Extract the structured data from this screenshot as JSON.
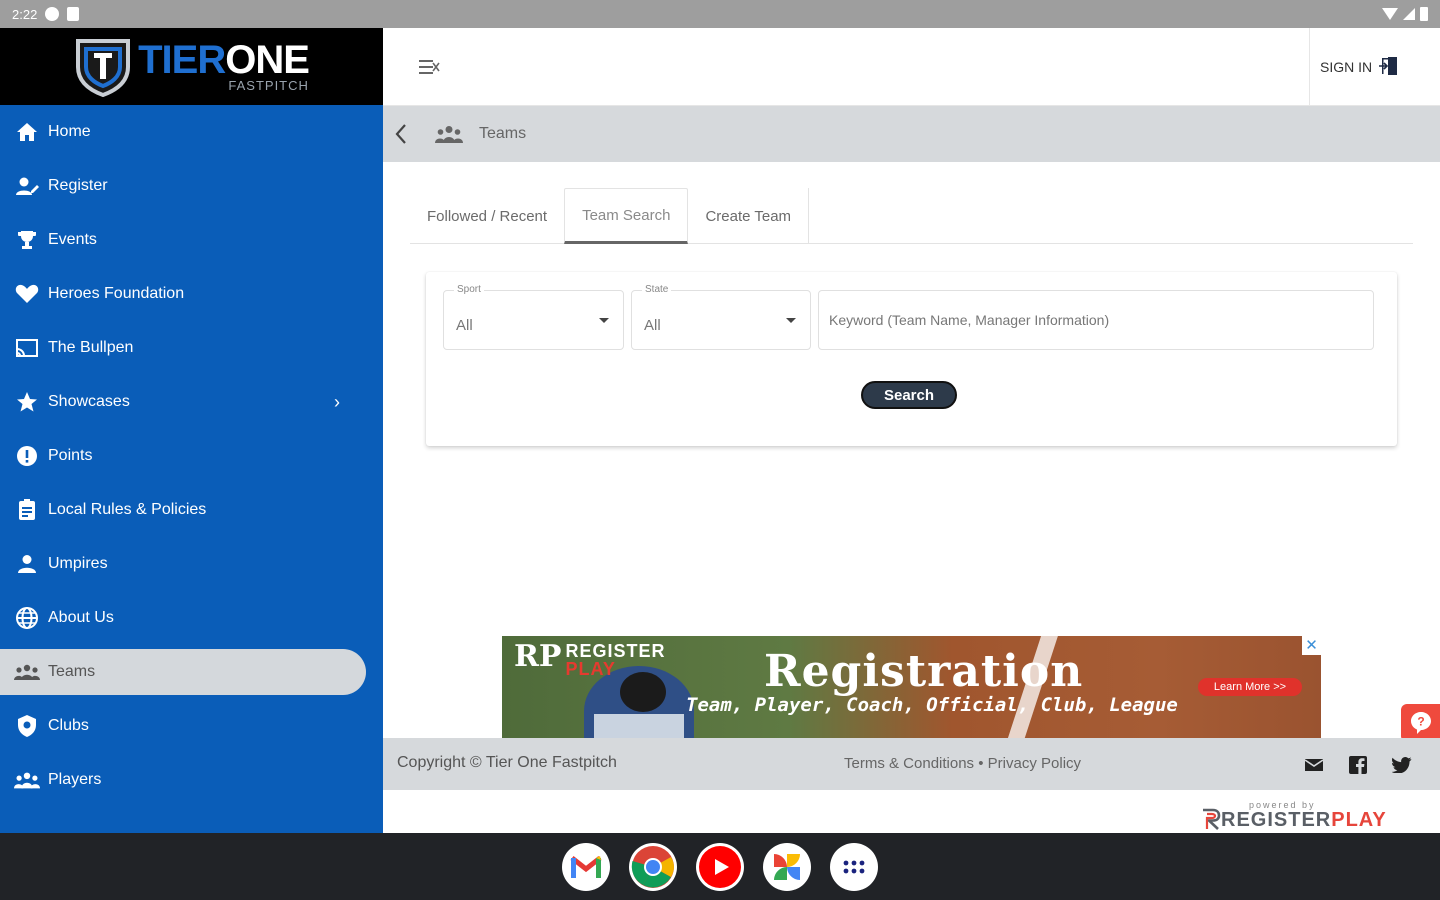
{
  "status_bar": {
    "time": "2:22"
  },
  "brand": {
    "name_part1": "TIER",
    "name_part2": "ONE",
    "sub": "FASTPITCH"
  },
  "sidebar": {
    "items": [
      {
        "label": "Home",
        "icon": "home-icon"
      },
      {
        "label": "Register",
        "icon": "person-edit-icon"
      },
      {
        "label": "Events",
        "icon": "trophy-icon"
      },
      {
        "label": "Heroes Foundation",
        "icon": "heart-icon"
      },
      {
        "label": "The Bullpen",
        "icon": "cast-icon"
      },
      {
        "label": "Showcases",
        "icon": "star-icon"
      },
      {
        "label": "Points",
        "icon": "alert-icon"
      },
      {
        "label": "Local Rules & Policies",
        "icon": "document-icon"
      },
      {
        "label": "Umpires",
        "icon": "person-icon"
      },
      {
        "label": "About Us",
        "icon": "globe-icon"
      },
      {
        "label": "Teams",
        "icon": "team-icon"
      },
      {
        "label": "Clubs",
        "icon": "shield-icon"
      },
      {
        "label": "Players",
        "icon": "group-icon"
      }
    ]
  },
  "topbar": {
    "signin_label": "SIGN IN"
  },
  "breadcrumb": {
    "current": "Teams"
  },
  "tabs": [
    {
      "label": "Followed / Recent"
    },
    {
      "label": "Team Search"
    },
    {
      "label": "Create Team"
    }
  ],
  "search": {
    "sport_label": "Sport",
    "sport_value": "All",
    "state_label": "State",
    "state_value": "All",
    "keyword_placeholder": "Keyword (Team Name, Manager Information)",
    "button_label": "Search"
  },
  "ad": {
    "brand_top": "REGISTER",
    "brand_bottom": "PLAY",
    "title": "Registration",
    "subtitle": "Team, Player, Coach, Official, Club, League",
    "cta": "Learn More >>"
  },
  "footer": {
    "copyright": "Copyright © Tier One Fastpitch",
    "terms": "Terms & Conditions",
    "separator": "•",
    "privacy": "Privacy Policy"
  },
  "powered": {
    "small": "powered by",
    "logo_a": "REGISTER",
    "logo_b": "PLAY"
  },
  "colors": {
    "sidebar": "#0a5db8",
    "accent_red": "#e6453b",
    "button": "#2d3a4a"
  }
}
